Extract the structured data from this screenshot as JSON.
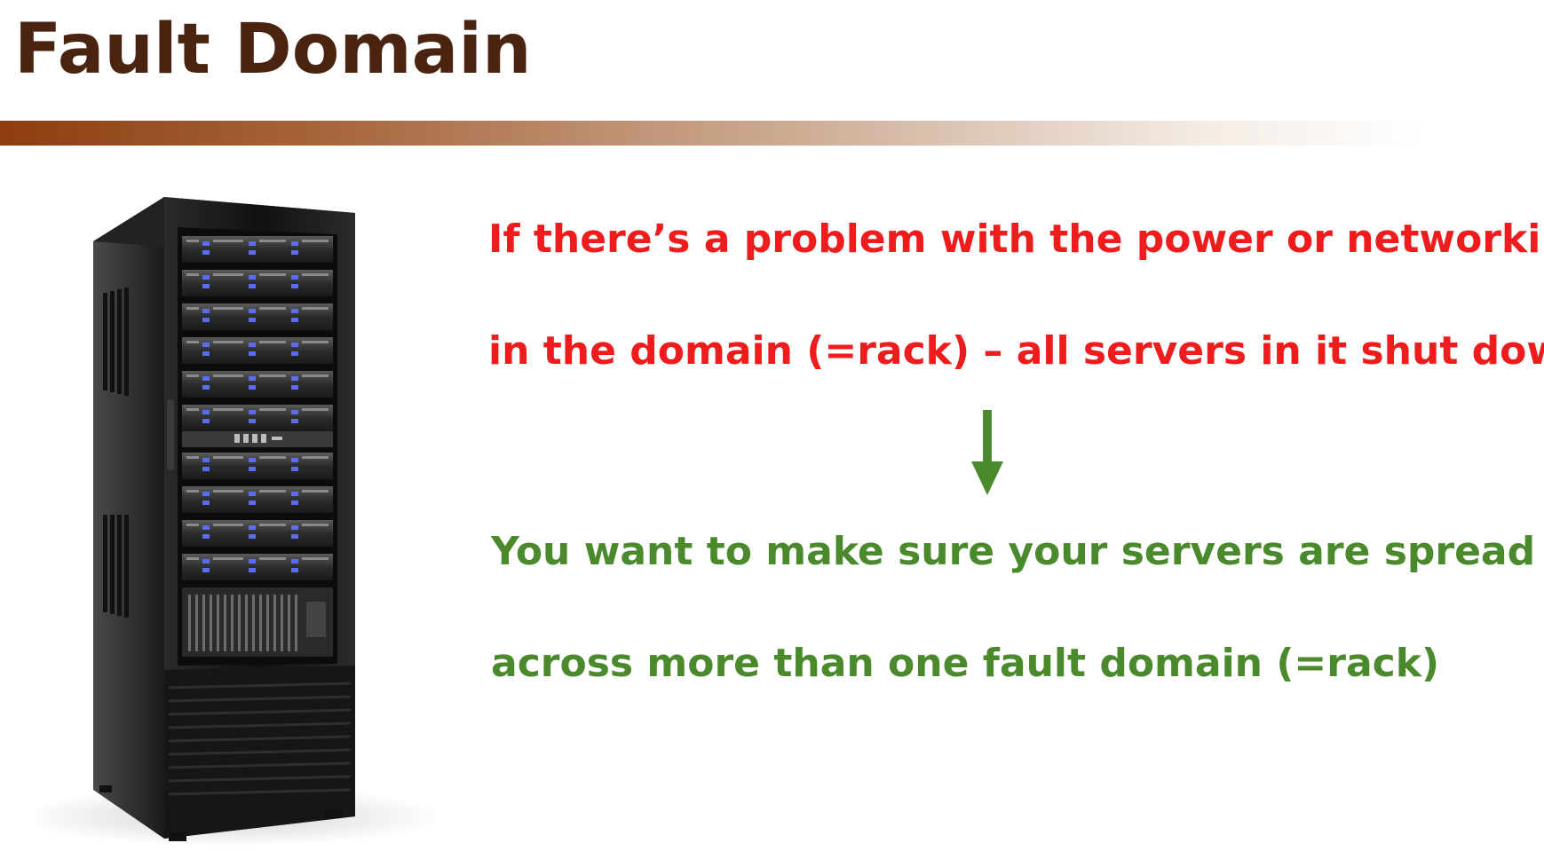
{
  "slide": {
    "title": "Fault Domain",
    "problem_lines": [
      "If there’s a problem with the power or networking",
      "in the domain (=rack) – all servers in it shut down"
    ],
    "solution_lines": [
      "You want to make sure your servers are spread",
      "across more than one fault domain (=rack)"
    ]
  },
  "colors": {
    "title": "#4a2410",
    "problem_text": "#ee1c1c",
    "solution_text": "#4b8a2c",
    "arrow": "#4b8a2c",
    "accent_bar": "#8e3d10"
  },
  "images": {
    "rack": "server-rack",
    "arrow": "down-arrow-icon"
  }
}
